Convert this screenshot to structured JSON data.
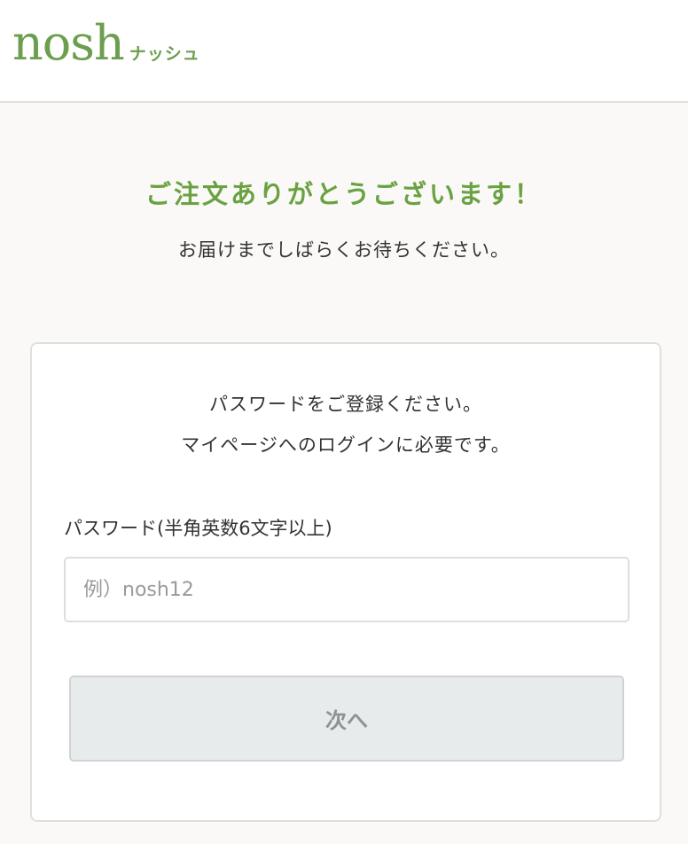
{
  "header": {
    "logo_text": "nosh",
    "logo_kana": "ナッシュ"
  },
  "thanks": {
    "title": "ご注文ありがとうございます！",
    "subtitle": "お届けまでしばらくお待ちください。"
  },
  "password_card": {
    "message_line1": "パスワードをご登録ください。",
    "message_line2": "マイページへのログインに必要です。",
    "field_label": "パスワード(半角英数6文字以上)",
    "input_value": "",
    "input_placeholder": "例）nosh12",
    "next_button_label": "次へ"
  },
  "colors": {
    "brand_green": "#6aa242",
    "logo_green": "#6b9e4e",
    "button_disabled_bg": "#e8ebec",
    "button_disabled_text": "#8f9293",
    "page_bg": "#faf9f7"
  }
}
